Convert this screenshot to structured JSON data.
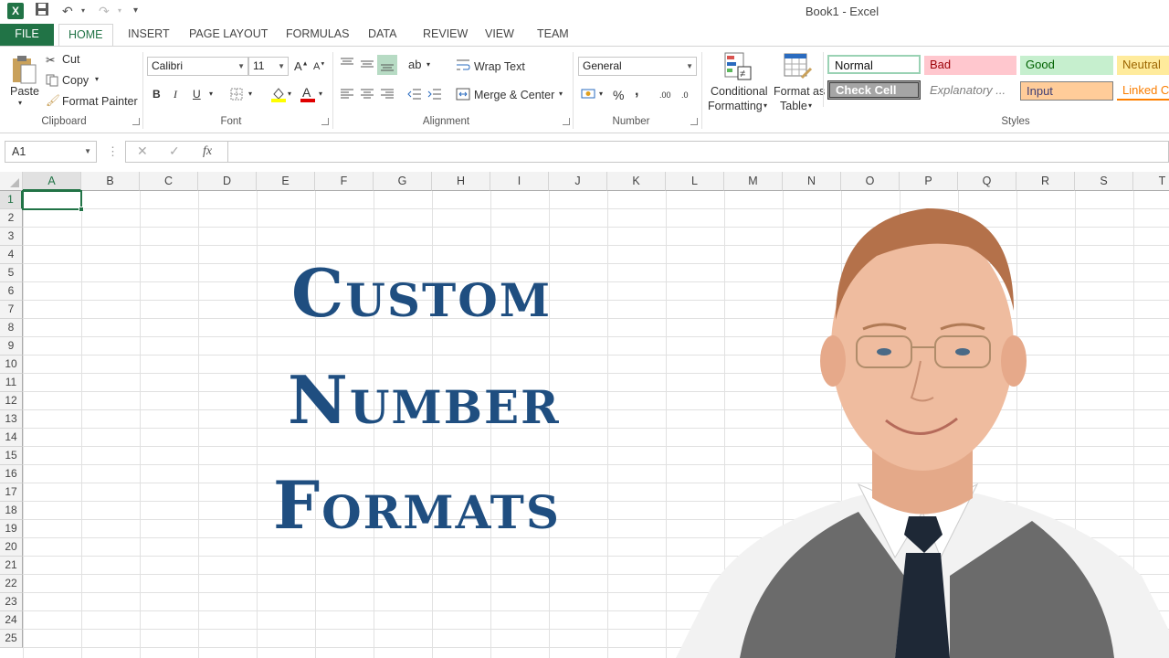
{
  "window": {
    "title": "Book1 - Excel"
  },
  "tabs": [
    "FILE",
    "HOME",
    "INSERT",
    "PAGE LAYOUT",
    "FORMULAS",
    "DATA",
    "REVIEW",
    "VIEW",
    "TEAM"
  ],
  "clipboard": {
    "paste": "Paste",
    "cut": "Cut",
    "copy": "Copy",
    "format_painter": "Format Painter",
    "label": "Clipboard"
  },
  "font": {
    "name": "Calibri",
    "size": "11",
    "bold": "B",
    "italic": "I",
    "underline": "U",
    "label": "Font"
  },
  "alignment": {
    "wrap_text": "Wrap Text",
    "merge_center": "Merge & Center",
    "label": "Alignment"
  },
  "number": {
    "format": "General",
    "percent": "%",
    "comma": ",",
    "inc_decimal": ".00",
    "dec_decimal": ".0",
    "label": "Number"
  },
  "styles": {
    "conditional_formatting": [
      "Conditional",
      "Formatting"
    ],
    "format_as_table": [
      "Format as",
      "Table"
    ],
    "cells": [
      "Normal",
      "Bad",
      "Good",
      "Neutral",
      "Check Cell",
      "Explanatory ...",
      "Input",
      "Linked C"
    ],
    "label": "Styles"
  },
  "formula_bar": {
    "name_box": "A1",
    "fx": "fx",
    "value": ""
  },
  "columns": [
    "A",
    "B",
    "C",
    "D",
    "E",
    "F",
    "G",
    "H",
    "I",
    "J",
    "K",
    "L",
    "M",
    "N",
    "O",
    "P",
    "Q",
    "R",
    "S",
    "T"
  ],
  "rows": [
    "1",
    "2",
    "3",
    "4",
    "5",
    "6",
    "7",
    "8",
    "9",
    "10",
    "11",
    "12",
    "13",
    "14",
    "15",
    "16",
    "17",
    "18",
    "19",
    "20",
    "21",
    "22",
    "23",
    "24",
    "25"
  ],
  "overlay": {
    "line1": "Custom",
    "line2": "Number",
    "line3": "Formats"
  },
  "colors": {
    "excel_green": "#217346",
    "title_blue": "#1f4e80"
  }
}
